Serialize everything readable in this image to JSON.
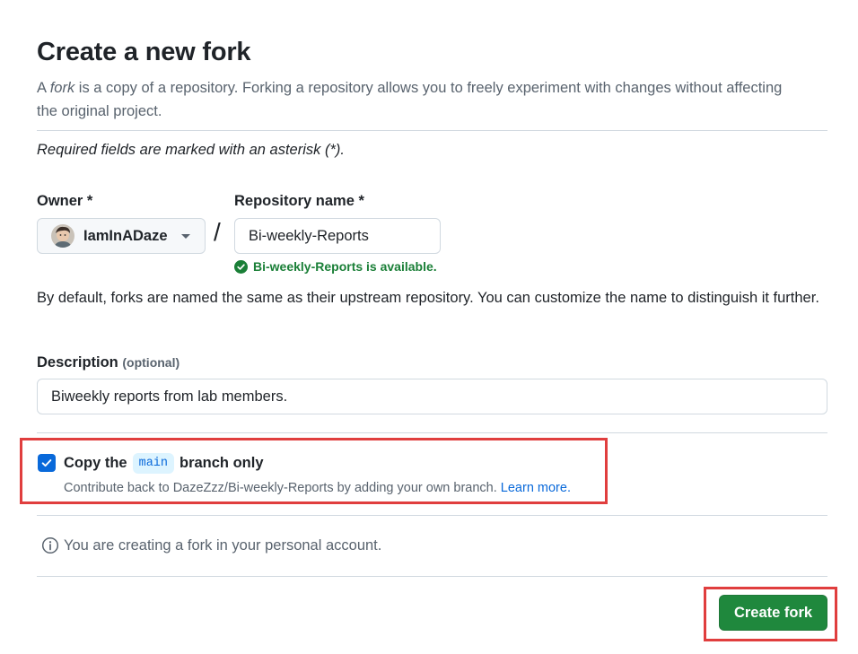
{
  "header": {
    "title": "Create a new fork",
    "intro_prefix": "A ",
    "intro_em": "fork",
    "intro_rest": " is a copy of a repository. Forking a repository allows you to freely experiment with changes without affecting the original project."
  },
  "required_note": "Required fields are marked with an asterisk (*).",
  "owner": {
    "label": "Owner *",
    "name": "IamInADaze",
    "avatar": "user-avatar"
  },
  "separator": "/",
  "repository": {
    "label": "Repository name *",
    "value": "Bi-weekly-Reports",
    "availability": "Bi-weekly-Reports is available.",
    "availability_icon": "check-circle-fill-icon"
  },
  "help_text": "By default, forks are named the same as their upstream repository. You can customize the name to distinguish it further.",
  "description": {
    "label": "Description",
    "optional": "(optional)",
    "value": "Biweekly reports from lab members."
  },
  "copy_branch": {
    "checked": true,
    "label_prefix": "Copy the",
    "branch": "main",
    "label_suffix": "branch only",
    "sub_text": "Contribute back to DazeZzz/Bi-weekly-Reports by adding your own branch.",
    "learn_more": "Learn more."
  },
  "notice": {
    "icon": "info-icon",
    "text": "You are creating a fork in your personal account."
  },
  "create_button": "Create fork",
  "colors": {
    "primary_button": "#1f883d",
    "accent": "#0969da",
    "success": "#1a7f37",
    "highlight": "#e03e3e"
  }
}
